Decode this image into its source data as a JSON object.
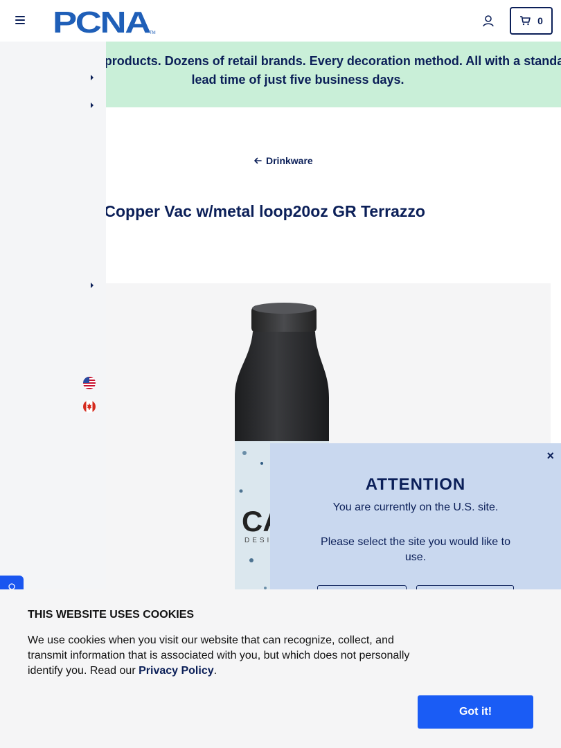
{
  "header": {
    "logo_text": "PCNA",
    "cart_count": "0"
  },
  "banner": {
    "text": "Thousands of products. Dozens of retail brands. Every decoration method. All with a standard lead time of just five business days."
  },
  "breadcrumb": {
    "back_label": "Drinkware"
  },
  "product": {
    "title": "Aqua Bottle Slim Copper Vac w/metal loop20oz GR Terrazzo",
    "label_text": "CAL",
    "label_sub": "DESIGN"
  },
  "attention": {
    "close_label": "×",
    "title": "ATTENTION",
    "message": "You are currently on the U.S. site.",
    "prompt": "Please select the site you would like to use."
  },
  "cookie": {
    "title": "THIS WEBSITE USES COOKIES",
    "text_before": "We use cookies when you visit our website that can recognize, collect, and transmit information that is associated with you, but which does not personally identify you. Read our ",
    "link_label": "Privacy Policy",
    "text_after": ".",
    "button_label": "Got it!"
  },
  "colors": {
    "navy": "#0b1f58",
    "banner_green": "#c9efd8",
    "modal_blue": "#c9d8ef",
    "button_blue": "#1a5cf5"
  },
  "icons": [
    "menu-icon",
    "user-icon",
    "cart-icon",
    "arrow-left-icon",
    "chevron-right-icon",
    "us-flag-icon",
    "canada-flag-icon",
    "chat-icon",
    "close-icon"
  ]
}
